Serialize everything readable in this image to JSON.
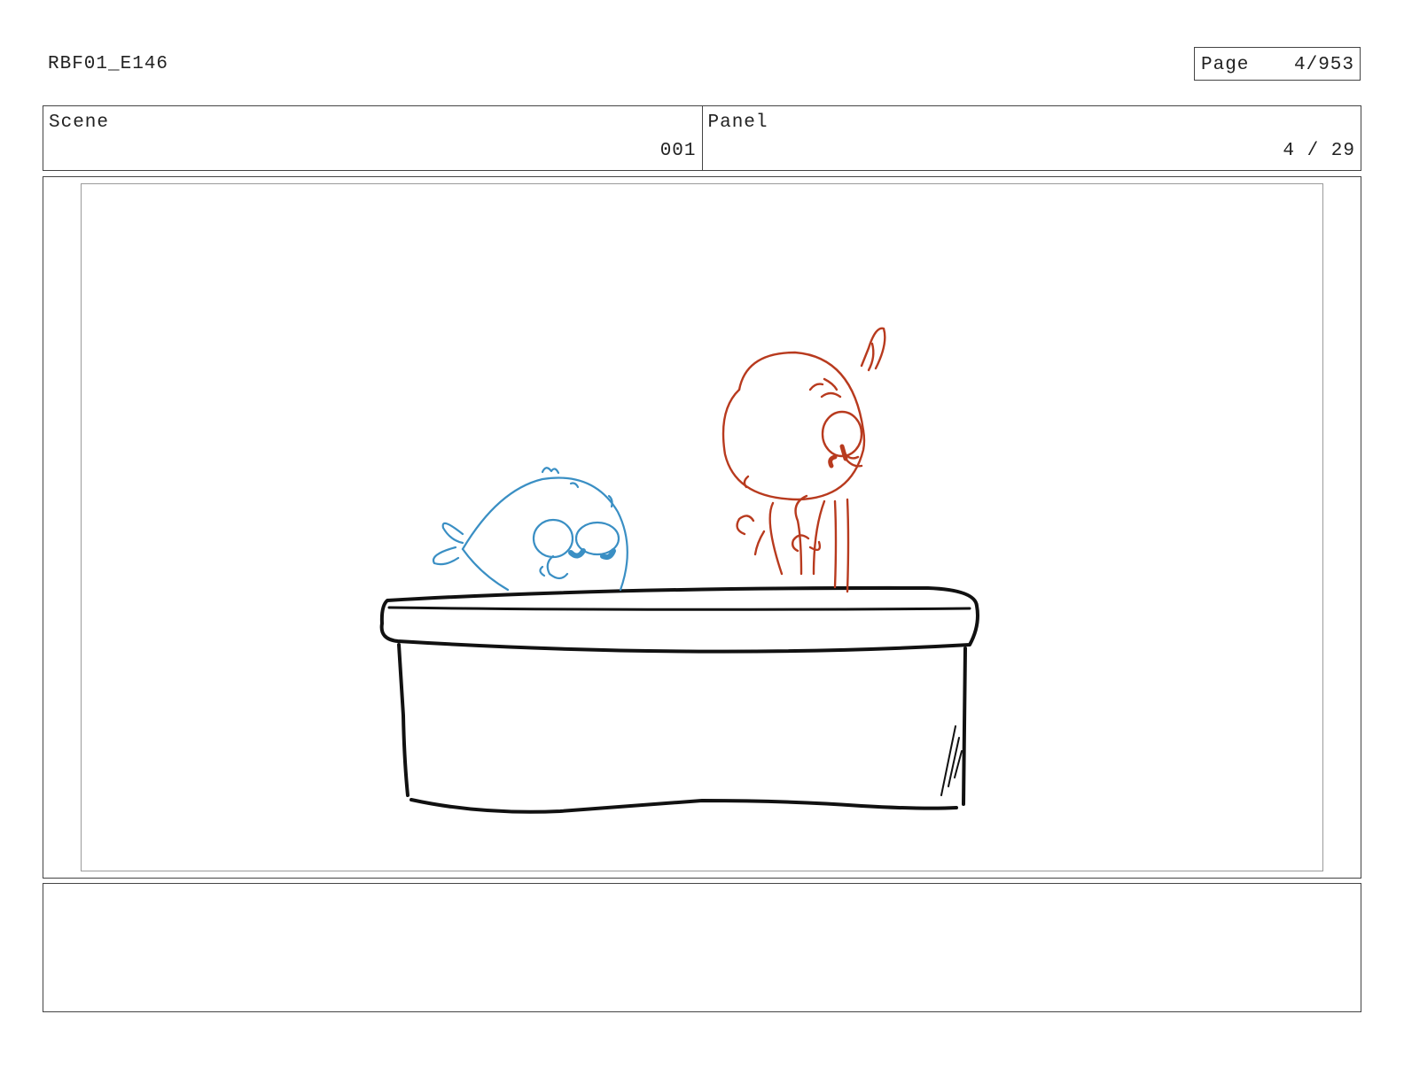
{
  "header": {
    "production_code": "RBF01_E146",
    "page_label": "Page",
    "page_value": "4/953"
  },
  "scene": {
    "label": "Scene",
    "value": "001"
  },
  "panel": {
    "label": "Panel",
    "value": "4 / 29"
  },
  "drawing": {
    "counter_color": "#111111",
    "blue_character_color": "#3a8fc4",
    "red_character_color": "#b83a1e"
  },
  "notes": {
    "text": ""
  }
}
